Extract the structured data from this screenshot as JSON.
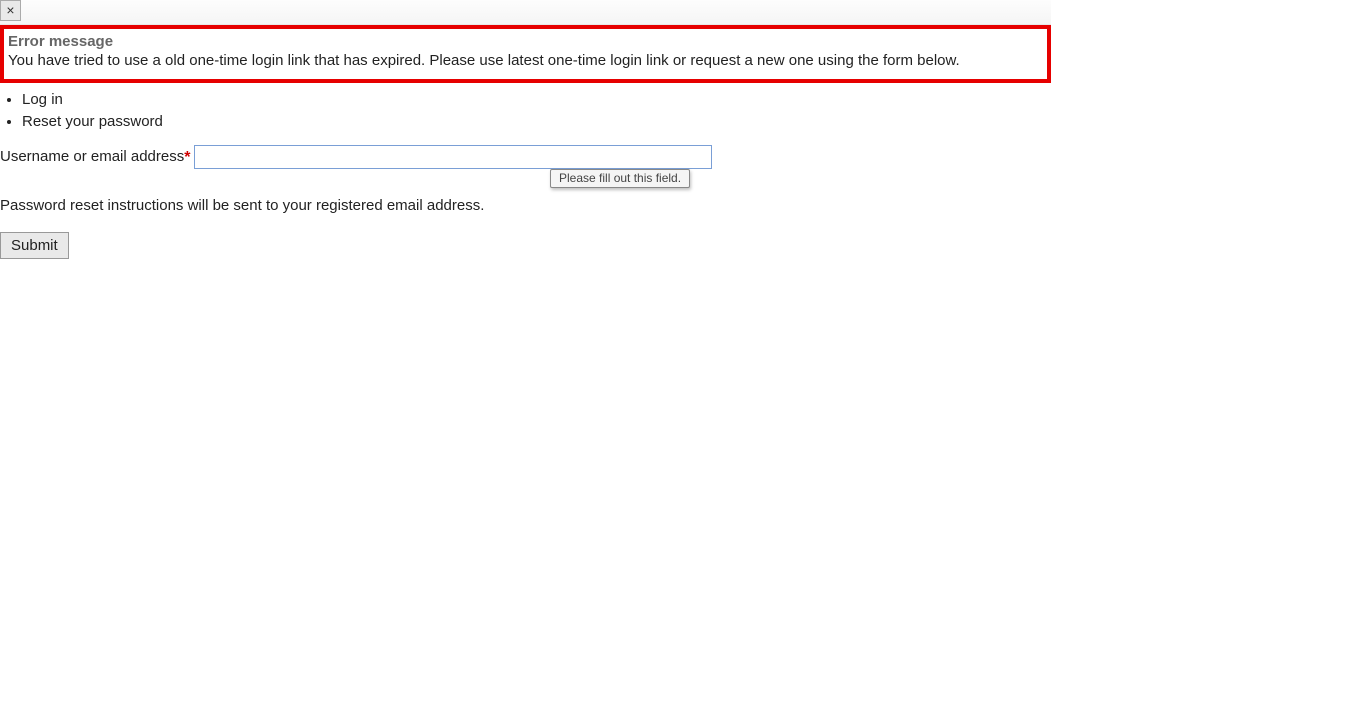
{
  "topbar": {
    "close_label": "×"
  },
  "error": {
    "title": "Error message",
    "body": "You have tried to use a old one-time login link that has expired. Please use latest one-time login link or request a new one using the form below."
  },
  "nav": {
    "login": "Log in",
    "reset": "Reset your password"
  },
  "form": {
    "label": "Username or email address",
    "required_marker": "*",
    "input_value": "",
    "tooltip": "Please fill out this field.",
    "help": "Password reset instructions will be sent to your registered email address.",
    "submit_label": "Submit"
  }
}
